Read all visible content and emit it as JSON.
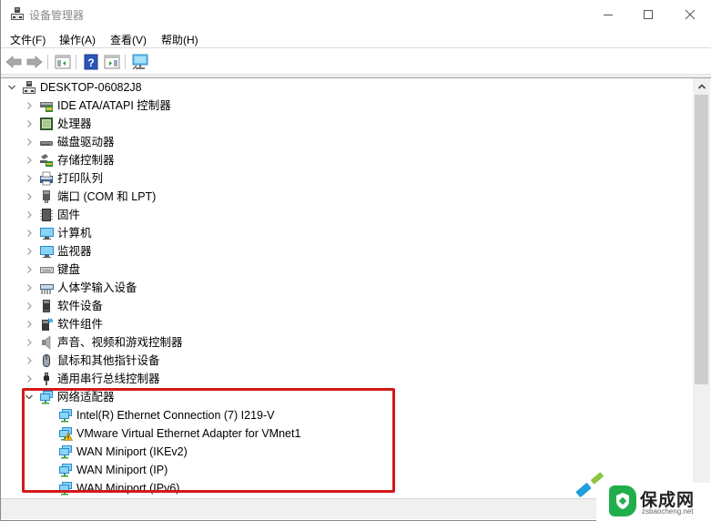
{
  "window": {
    "title": "设备管理器",
    "controls": {
      "minimize": "minimize",
      "maximize": "maximize",
      "close": "close"
    }
  },
  "menu": {
    "items": [
      {
        "label": "文件(F)"
      },
      {
        "label": "操作(A)"
      },
      {
        "label": "查看(V)"
      },
      {
        "label": "帮助(H)"
      }
    ]
  },
  "toolbar": {
    "buttons": [
      {
        "icon": "back-arrow-icon",
        "tooltip": "后退"
      },
      {
        "icon": "forward-arrow-icon",
        "tooltip": "前进"
      },
      {
        "icon": "show-hide-console-tree-icon"
      },
      {
        "icon": "help-icon"
      },
      {
        "icon": "show-hide-action-pane-icon"
      },
      {
        "icon": "scan-hardware-icon"
      }
    ]
  },
  "tree": {
    "root": {
      "label": "DESKTOP-06082J8",
      "expanded": true,
      "icon": "computer-tower-icon"
    },
    "categories": [
      {
        "label": "IDE ATA/ATAPI 控制器",
        "icon": "ide-controller-icon",
        "expanded": false
      },
      {
        "label": "处理器",
        "icon": "processor-icon",
        "expanded": false
      },
      {
        "label": "磁盘驱动器",
        "icon": "disk-drive-icon",
        "expanded": false
      },
      {
        "label": "存储控制器",
        "icon": "storage-controller-icon",
        "expanded": false
      },
      {
        "label": "打印队列",
        "icon": "printer-icon",
        "expanded": false
      },
      {
        "label": "端口 (COM 和 LPT)",
        "icon": "port-icon",
        "expanded": false
      },
      {
        "label": "固件",
        "icon": "firmware-icon",
        "expanded": false
      },
      {
        "label": "计算机",
        "icon": "computer-icon",
        "expanded": false
      },
      {
        "label": "监视器",
        "icon": "monitor-icon",
        "expanded": false
      },
      {
        "label": "键盘",
        "icon": "keyboard-icon",
        "expanded": false
      },
      {
        "label": "人体学输入设备",
        "icon": "hid-icon",
        "expanded": false
      },
      {
        "label": "软件设备",
        "icon": "software-device-icon",
        "expanded": false
      },
      {
        "label": "软件组件",
        "icon": "software-component-icon",
        "expanded": false
      },
      {
        "label": "声音、视频和游戏控制器",
        "icon": "speaker-icon",
        "expanded": false
      },
      {
        "label": "鼠标和其他指针设备",
        "icon": "mouse-icon",
        "expanded": false
      },
      {
        "label": "通用串行总线控制器",
        "icon": "usb-icon",
        "expanded": false
      },
      {
        "label": "网络适配器",
        "icon": "network-adapter-icon",
        "expanded": true
      }
    ],
    "network_adapters": [
      {
        "label": "Intel(R) Ethernet Connection (7) I219-V",
        "warning": false
      },
      {
        "label": "VMware Virtual Ethernet Adapter for VMnet1",
        "warning": true
      },
      {
        "label": "WAN Miniport (IKEv2)",
        "warning": false
      },
      {
        "label": "WAN Miniport (IP)",
        "warning": false
      },
      {
        "label": "WAN Miniport (IPv6)",
        "warning": false
      }
    ]
  },
  "scrollbar": {
    "position_fraction": 0.0,
    "visible_fraction": 0.72
  },
  "annotation": {
    "highlight_color": "#d41919",
    "highlight_target": "网络适配器"
  },
  "watermark": {
    "title": "保成网",
    "url": "zsbaocheng.net",
    "brand_color": "#1fae4b"
  }
}
